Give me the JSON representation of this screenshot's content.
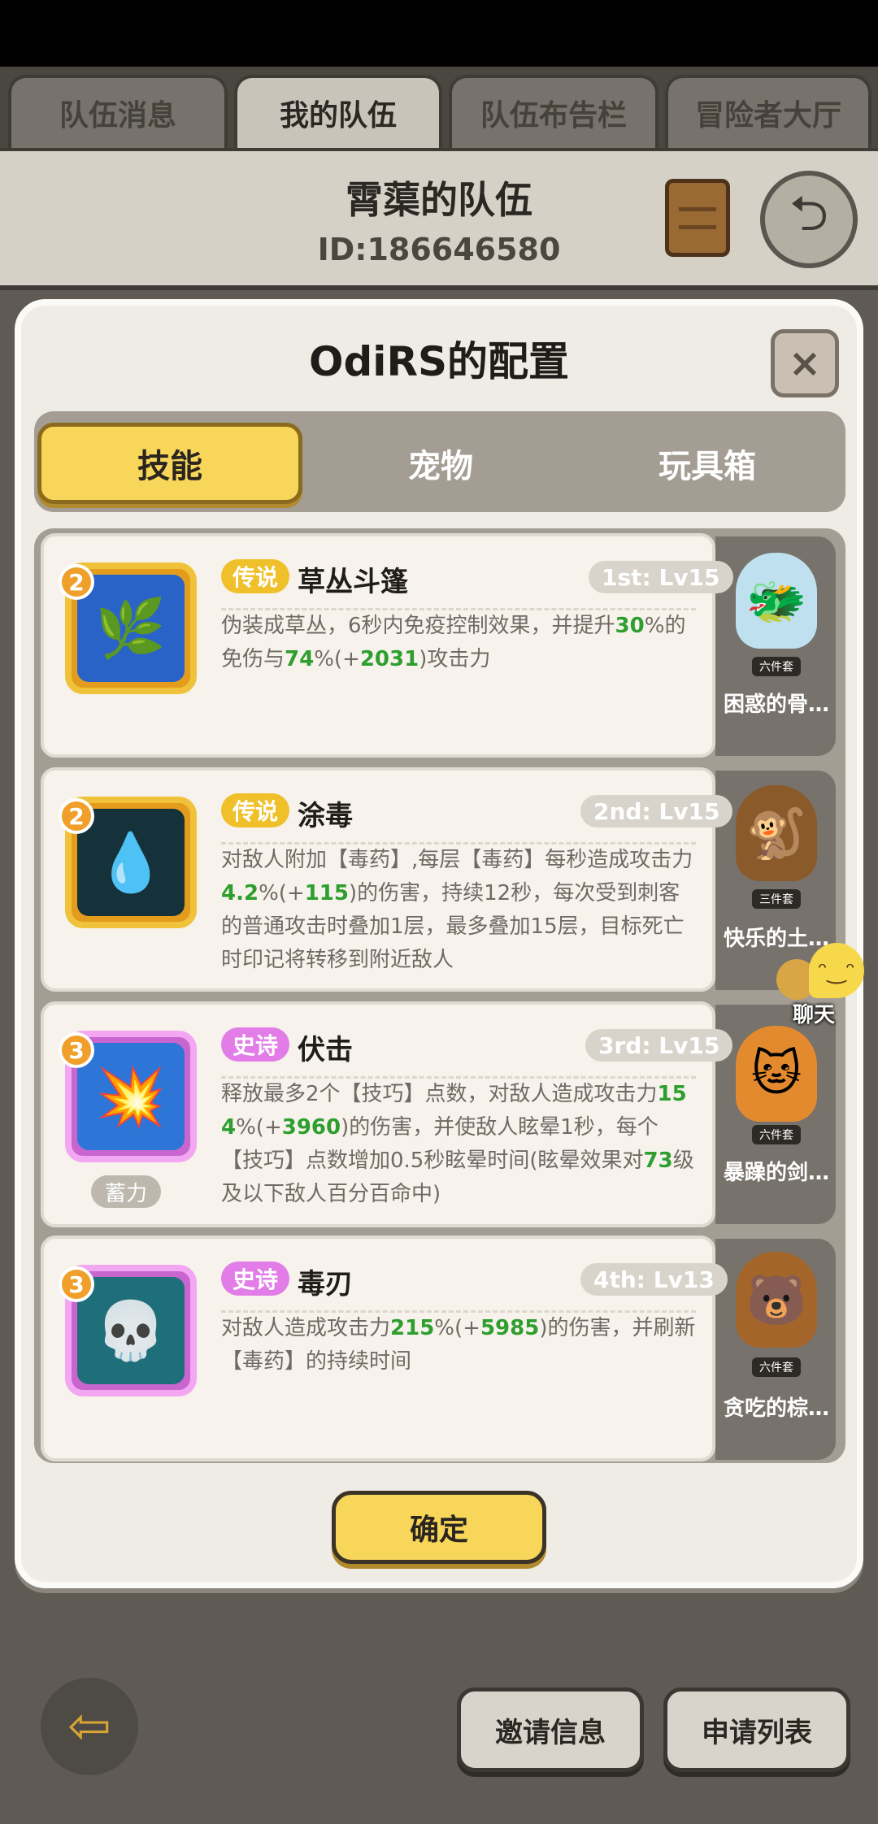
{
  "top_tabs": [
    "队伍消息",
    "我的队伍",
    "队伍布告栏",
    "冒险者大厅"
  ],
  "team": {
    "name": "霄蕖的队伍",
    "id": "ID:186646580"
  },
  "modal": {
    "title": "OdiRS的配置",
    "close": "×",
    "tabs": [
      "技能",
      "宠物",
      "玩具箱"
    ]
  },
  "skills": [
    {
      "level_badge": "2",
      "rarity": "传说",
      "name": "草丛斗篷",
      "slot": "1st: Lv15",
      "desc_parts": [
        "伪装成草丛，6秒内免疫控制效果，并提升",
        "30",
        "%的免伤与",
        "74",
        "%(+",
        "2031",
        ")攻击力"
      ]
    },
    {
      "level_badge": "2",
      "rarity": "传说",
      "name": "涂毒",
      "slot": "2nd: Lv15",
      "desc_parts": [
        "对敌人附加【毒药】,每层【毒药】每秒造成攻击力",
        "4.2",
        "%(+",
        "115",
        ")的伤害，持续12秒，每次受到刺客的普通攻击时叠加1层，最多叠加15层，目标死亡时印记将转移到附近敌人"
      ]
    },
    {
      "level_badge": "3",
      "rarity": "史诗",
      "name": "伏击",
      "slot": "3rd: Lv15",
      "sub_label": "蓄力",
      "desc_parts": [
        "释放最多2个【技巧】点数，对敌人造成攻击力",
        "154",
        "%(+",
        "3960",
        ")的伤害，并使敌人眩晕1秒，每个【技巧】点数增加0.5秒眩晕时间(眩晕效果对",
        "73",
        "级及以下敌人百分百命中)"
      ]
    },
    {
      "level_badge": "3",
      "rarity": "史诗",
      "name": "毒刃",
      "slot": "4th: Lv13",
      "desc_parts": [
        "对敌人造成攻击力",
        "215",
        "%(+",
        "5985",
        ")的伤害，并刷新【毒药】的持续时间"
      ]
    }
  ],
  "pets": [
    {
      "set": "六件套",
      "name": "困惑的骨…",
      "color": "#bfe0ee"
    },
    {
      "set": "三件套",
      "name": "快乐的土…",
      "color": "#8a5a2b"
    },
    {
      "set": "六件套",
      "name": "暴躁的剑…",
      "color": "#e48a2e"
    },
    {
      "set": "六件套",
      "name": "贪吃的棕…",
      "color": "#a4652a"
    }
  ],
  "chat": {
    "label": "聊天"
  },
  "confirm": "确定",
  "bottom": {
    "back": "⇦",
    "invite": "邀请信息",
    "apply": "申请列表"
  }
}
